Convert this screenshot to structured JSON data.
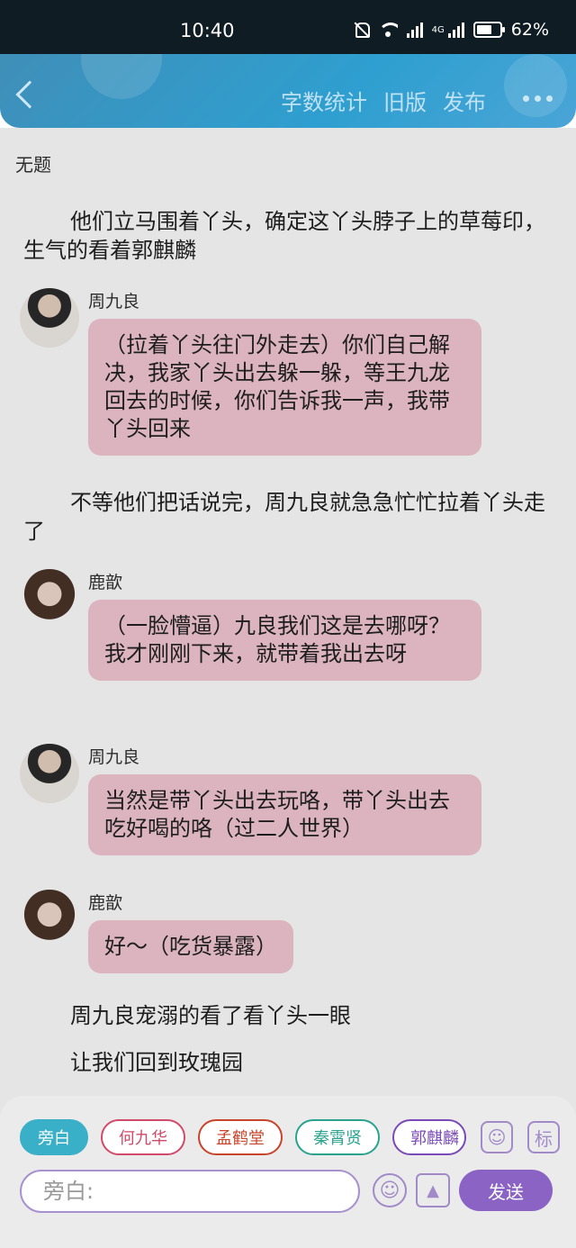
{
  "status_bar": {
    "time": "10:40",
    "network": "4G",
    "battery": "62%"
  },
  "app_bar": {
    "actions": [
      "字数统计",
      "旧版",
      "发布"
    ]
  },
  "document": {
    "title": "无题"
  },
  "script": {
    "narration_1": "他们立马围着丫头，确定这丫头脖子上的草莓印，生气的看着郭麒麟",
    "msg_1": {
      "speaker": "周九良",
      "text": "（拉着丫头往门外走去）你们自己解决，我家丫头出去躲一躲，等王九龙回去的时候，你们告诉我一声，我带丫头回来"
    },
    "narration_2": "不等他们把话说完，周九良就急急忙忙拉着丫头走了",
    "msg_2": {
      "speaker": "鹿歆",
      "text": "（一脸懵逼）九良我们这是去哪呀？我才刚刚下来，就带着我出去呀"
    },
    "msg_3": {
      "speaker": "周九良",
      "text": "当然是带丫头出去玩咯，带丫头出去吃好喝的咯（过二人世界）"
    },
    "msg_4": {
      "speaker": "鹿歆",
      "text": "好～（吃货暴露）"
    },
    "narration_3": "周九良宠溺的看了看丫头一眼",
    "narration_4": "让我们回到玫瑰园"
  },
  "composer": {
    "roles": [
      "旁白",
      "何九华",
      "孟鹤堂",
      "秦霄贤",
      "郭麒麟"
    ],
    "active_role": "旁白",
    "role_colors": {
      "旁白": "#3ab0c8",
      "何九华": "#d24a6a",
      "孟鹤堂": "#c8452c",
      "秦霄贤": "#2aa38e",
      "郭麒麟": "#7a4ab8"
    },
    "tag_button": "标",
    "input_placeholder": "旁白:",
    "send_label": "发送"
  },
  "colors": {
    "app_bar": "#2e9fd0",
    "bubble": "#f5c9d5",
    "send_button": "#8a63c4"
  },
  "icons": [
    "back-icon",
    "more-icon",
    "character-icon",
    "emoji-icon",
    "image-icon"
  ]
}
